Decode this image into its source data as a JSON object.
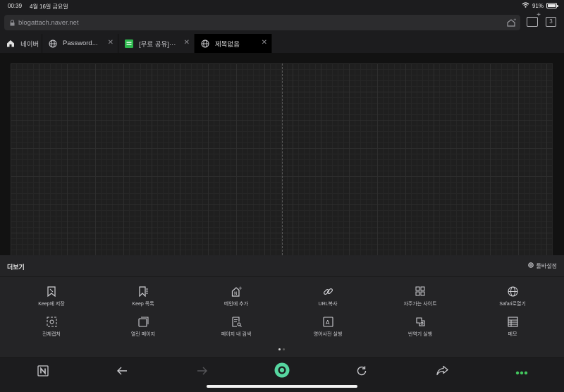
{
  "status": {
    "time": "00:39",
    "date": "4월 16일 금요일",
    "battery": "91%"
  },
  "address": {
    "url": "blogattach.naver.net",
    "tab_count": "3"
  },
  "tabs": [
    {
      "label": "네이버",
      "icon": "home-icon",
      "active": false
    },
    {
      "label": "Password...",
      "icon": "globe-icon",
      "active": false
    },
    {
      "label": "[무료 공유]···",
      "icon": "blog-icon",
      "active": false
    },
    {
      "label": "제목없음",
      "icon": "globe-icon",
      "active": true
    }
  ],
  "panel": {
    "title": "더보기",
    "settings_label": "툴바설정",
    "row1": [
      {
        "label": "Keep에 저장",
        "icon": "keep-save-icon"
      },
      {
        "label": "Keep 목록",
        "icon": "keep-list-icon"
      },
      {
        "label": "메인에 추가",
        "icon": "add-to-main-icon"
      },
      {
        "label": "URL복사",
        "icon": "link-icon"
      },
      {
        "label": "자주가는 사이트",
        "icon": "grid-icon"
      },
      {
        "label": "Safari로열기",
        "icon": "globe-icon"
      }
    ],
    "row2": [
      {
        "label": "전체캡처",
        "icon": "capture-icon"
      },
      {
        "label": "열린 페이지",
        "icon": "pages-icon"
      },
      {
        "label": "페이지 내 검색",
        "icon": "page-search-icon"
      },
      {
        "label": "영어사전 실행",
        "icon": "dictionary-icon"
      },
      {
        "label": "번역기 실행",
        "icon": "translate-icon"
      },
      {
        "label": "메모",
        "icon": "memo-icon"
      }
    ],
    "page_indicator": {
      "current": 1,
      "total": 2
    }
  },
  "toolbar": {
    "items": [
      "naver-n-icon",
      "back-icon",
      "forward-icon",
      "green-dot-icon",
      "refresh-icon",
      "share-icon",
      "more-icon"
    ],
    "accent": "#56d6a0",
    "more_color": "#43c65e"
  }
}
